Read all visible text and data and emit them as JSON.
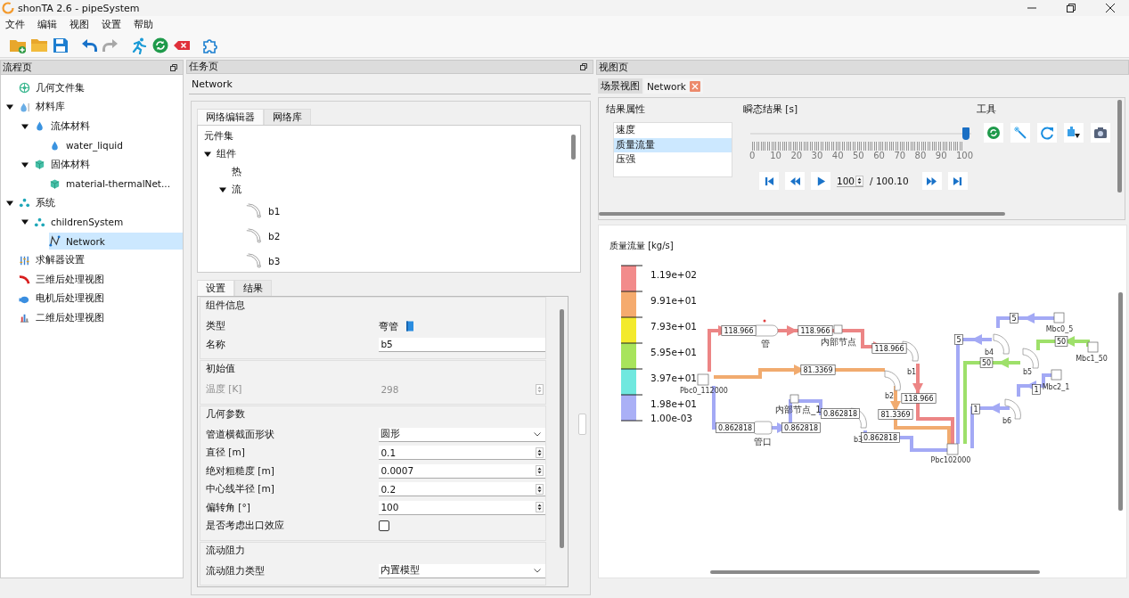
{
  "window": {
    "title": "shonTA 2.6 - pipeSystem"
  },
  "menu": [
    "文件",
    "编辑",
    "视图",
    "设置",
    "帮助"
  ],
  "toolbar": [
    {
      "kind": "new-folder",
      "disabled": false
    },
    {
      "kind": "folder",
      "disabled": false
    },
    {
      "kind": "save",
      "disabled": false
    },
    {
      "kind": "undo",
      "disabled": false
    },
    {
      "kind": "redo",
      "disabled": true
    },
    {
      "kind": "run",
      "disabled": false
    },
    {
      "kind": "refresh",
      "disabled": false
    },
    {
      "kind": "stop",
      "disabled": false
    },
    {
      "kind": "puzzle",
      "disabled": false
    }
  ],
  "left_panel": {
    "title": "流程页",
    "tree": [
      {
        "label": "几何文件集",
        "kind": "geometry",
        "selected": false
      },
      {
        "label": "材料库",
        "kind": "library",
        "selected": false,
        "expanded": true,
        "children": [
          {
            "label": "流体材料",
            "kind": "drop",
            "selected": false,
            "expanded": true,
            "children": [
              {
                "label": "water_liquid",
                "kind": "drop",
                "selected": false
              }
            ]
          },
          {
            "label": "固体材料",
            "kind": "cube",
            "selected": false,
            "expanded": true,
            "children": [
              {
                "label": "material-thermalNet...",
                "kind": "cube",
                "selected": false
              }
            ]
          }
        ]
      },
      {
        "label": "系统",
        "kind": "system",
        "selected": false,
        "expanded": true,
        "children": [
          {
            "label": "childrenSystem",
            "kind": "system",
            "selected": false,
            "expanded": true,
            "children": [
              {
                "label": "Network",
                "kind": "network",
                "selected": true
              }
            ]
          }
        ]
      },
      {
        "label": "求解器设置",
        "kind": "solver",
        "selected": false
      },
      {
        "label": "三维后处理视图",
        "kind": "view3d",
        "selected": false
      },
      {
        "label": "电机后处理视图",
        "kind": "motor",
        "selected": false
      },
      {
        "label": "二维后处理视图",
        "kind": "view2d",
        "selected": false
      }
    ]
  },
  "task_panel": {
    "title": "任务页",
    "heading": "Network",
    "editor_tabs": [
      {
        "label": "网络编辑器",
        "selected": true
      },
      {
        "label": "网络库",
        "selected": false
      }
    ],
    "component_tree": [
      {
        "label": "元件集",
        "kind": "plain"
      },
      {
        "label": "组件",
        "kind": "plain",
        "expanded": true,
        "children": [
          {
            "label": "热",
            "kind": "plain"
          },
          {
            "label": "流",
            "kind": "plain",
            "expanded": true,
            "children": [
              {
                "label": "b1",
                "kind": "bend"
              },
              {
                "label": "b2",
                "kind": "bend"
              },
              {
                "label": "b3",
                "kind": "bend"
              }
            ]
          }
        ]
      }
    ],
    "settings_tabs": [
      {
        "label": "设置",
        "selected": true
      },
      {
        "label": "结果",
        "selected": false
      }
    ],
    "groups": [
      {
        "title": "组件信息",
        "rows": [
          {
            "kind": "type",
            "label": "类型",
            "value": "弯管"
          },
          {
            "kind": "text",
            "label": "名称",
            "value": "b5"
          }
        ]
      },
      {
        "title": "初始值",
        "rows": [
          {
            "kind": "spin",
            "label": "温度 [K]",
            "value": "298",
            "disabled": true
          }
        ]
      },
      {
        "title": "几何参数",
        "rows": [
          {
            "kind": "select",
            "label": "管道横截面形状",
            "value": "圆形"
          },
          {
            "kind": "spin",
            "label": "直径 [m]",
            "value": "0.1",
            "disabled": false
          },
          {
            "kind": "spin",
            "label": "绝对粗糙度 [m]",
            "value": "0.0007",
            "disabled": false
          },
          {
            "kind": "spin",
            "label": "中心线半径 [m]",
            "value": "0.2",
            "disabled": false
          },
          {
            "kind": "spin",
            "label": "偏转角 [°]",
            "value": "100",
            "disabled": false
          },
          {
            "kind": "checkbox",
            "label": "是否考虑出口效应",
            "checked": false
          }
        ]
      },
      {
        "title": "流动阻力",
        "rows": [
          {
            "kind": "select",
            "label": "流动阻力类型",
            "value": "内置模型"
          }
        ]
      }
    ]
  },
  "view_panel": {
    "title": "视图页",
    "tabs": [
      {
        "label": "场景视图",
        "selected": false,
        "closable": false
      },
      {
        "label": "Network",
        "selected": true,
        "closable": true
      }
    ],
    "results": {
      "heading": "结果属性",
      "items": [
        {
          "label": "速度",
          "selected": false
        },
        {
          "label": "质量流量",
          "selected": true
        },
        {
          "label": "压强",
          "selected": false
        }
      ]
    },
    "transient": {
      "heading": "瞬态结果 [s]",
      "level": 1.0,
      "ticks": [
        "0",
        "10",
        "20",
        "30",
        "40",
        "50",
        "60",
        "70",
        "80",
        "90",
        "100"
      ],
      "frame": "100",
      "total": "/ 100.10"
    },
    "tools": {
      "heading": "工具"
    },
    "legend": {
      "title": "质量流量 [kg/s]",
      "bands": [
        {
          "color": "#f28b8b",
          "label": "1.19e+02"
        },
        {
          "color": "#f5ab6e",
          "label": "9.91e+01"
        },
        {
          "color": "#f3ea2c",
          "label": "7.93e+01"
        },
        {
          "color": "#a8e45c",
          "label": "5.95e+01"
        },
        {
          "color": "#70e8df",
          "label": "3.97e+01"
        },
        {
          "color": "#aab0f6",
          "label": "1.98e+01"
        }
      ],
      "min_label": "1.00e-03"
    },
    "pipes": [
      {
        "color": "#ec8585"
      },
      {
        "color": "#f1ab6f"
      },
      {
        "color": "#a3a9f5"
      },
      {
        "color": "#a3a9f5"
      },
      {
        "color": "#9ee06a"
      },
      {
        "color": "#a3a9f5"
      }
    ],
    "labels": [
      {
        "kind": "value",
        "text": "118.966"
      },
      {
        "kind": "value",
        "text": "118.966"
      },
      {
        "kind": "value",
        "text": "118.966"
      },
      {
        "kind": "value",
        "text": "118.966"
      },
      {
        "kind": "value",
        "text": "81.3369"
      },
      {
        "kind": "value",
        "text": "81.3369"
      },
      {
        "kind": "value",
        "text": "0.862818"
      },
      {
        "kind": "value",
        "text": "0.862818"
      },
      {
        "kind": "value",
        "text": "0.862818"
      },
      {
        "kind": "value",
        "text": "0.862818"
      },
      {
        "kind": "value",
        "text": "5"
      },
      {
        "kind": "value",
        "text": "5"
      },
      {
        "kind": "value",
        "text": "50"
      },
      {
        "kind": "value",
        "text": "50"
      },
      {
        "kind": "value",
        "text": "1"
      },
      {
        "kind": "value",
        "text": "1"
      },
      {
        "kind": "name",
        "text": "管"
      },
      {
        "kind": "name",
        "text": "内部节点"
      },
      {
        "kind": "name",
        "text": "b1"
      },
      {
        "kind": "name",
        "text": "b2"
      },
      {
        "kind": "name",
        "text": "b3"
      },
      {
        "kind": "name",
        "text": "Pbc0_112000"
      },
      {
        "kind": "name",
        "text": "管口"
      },
      {
        "kind": "name",
        "text": "内部节点_1"
      },
      {
        "kind": "name",
        "text": "Pbc102000"
      },
      {
        "kind": "name",
        "text": "b4"
      },
      {
        "kind": "name",
        "text": "b5"
      },
      {
        "kind": "name",
        "text": "b6"
      },
      {
        "kind": "name",
        "text": "Mbc0_5"
      },
      {
        "kind": "name",
        "text": "Mbc1_50"
      },
      {
        "kind": "name",
        "text": "Mbc2_1"
      }
    ]
  }
}
